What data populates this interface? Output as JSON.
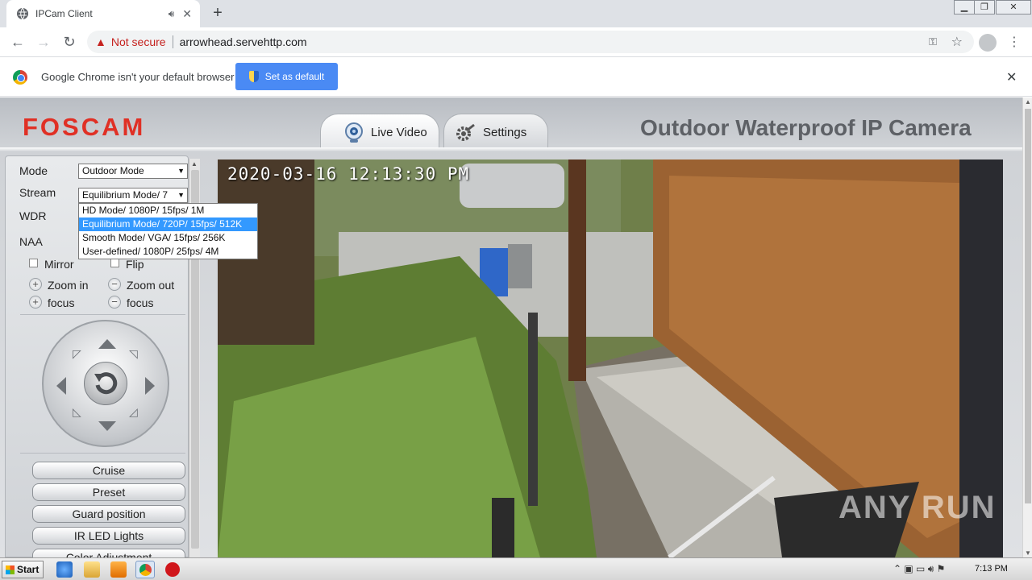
{
  "browser": {
    "tab_title": "IPCam Client",
    "new_tab": "+",
    "not_secure": "Not secure",
    "url": "arrowhead.servehttp.com",
    "infobar_message": "Google Chrome isn't your default browser",
    "set_default_label": "Set as default"
  },
  "page": {
    "logo": "FOSCAM",
    "nav_live": "Live Video",
    "nav_settings": "Settings",
    "camera_title": "Outdoor Waterproof IP Camera"
  },
  "controls": {
    "mode_label": "Mode",
    "mode_value": "Outdoor Mode",
    "stream_label": "Stream",
    "stream_value": "Equilibrium Mode/ 7",
    "wdr_label": "WDR",
    "naa_label": "NAA",
    "mirror_label": "Mirror",
    "flip_label": "Flip",
    "zoom_in_label": "Zoom in",
    "zoom_out_label": "Zoom out",
    "focus_plus_label": "focus",
    "focus_minus_label": "focus",
    "stream_options": [
      "HD Mode/ 1080P/ 15fps/ 1M",
      "Equilibrium Mode/ 720P/ 15fps/ 512K",
      "Smooth Mode/ VGA/ 15fps/ 256K",
      "User-defined/ 1080P/ 25fps/ 4M"
    ],
    "selected_stream_index": 1
  },
  "actions": {
    "cruise": "Cruise",
    "preset": "Preset",
    "guard_position": "Guard position",
    "ir_led": "IR LED Lights",
    "color_adjustment": "Color Adjustment"
  },
  "video": {
    "timestamp": "2020-03-16 12:13:30 PM",
    "watermark": "ANY RUN"
  },
  "taskbar": {
    "start": "Start",
    "time": "7:13 PM"
  }
}
